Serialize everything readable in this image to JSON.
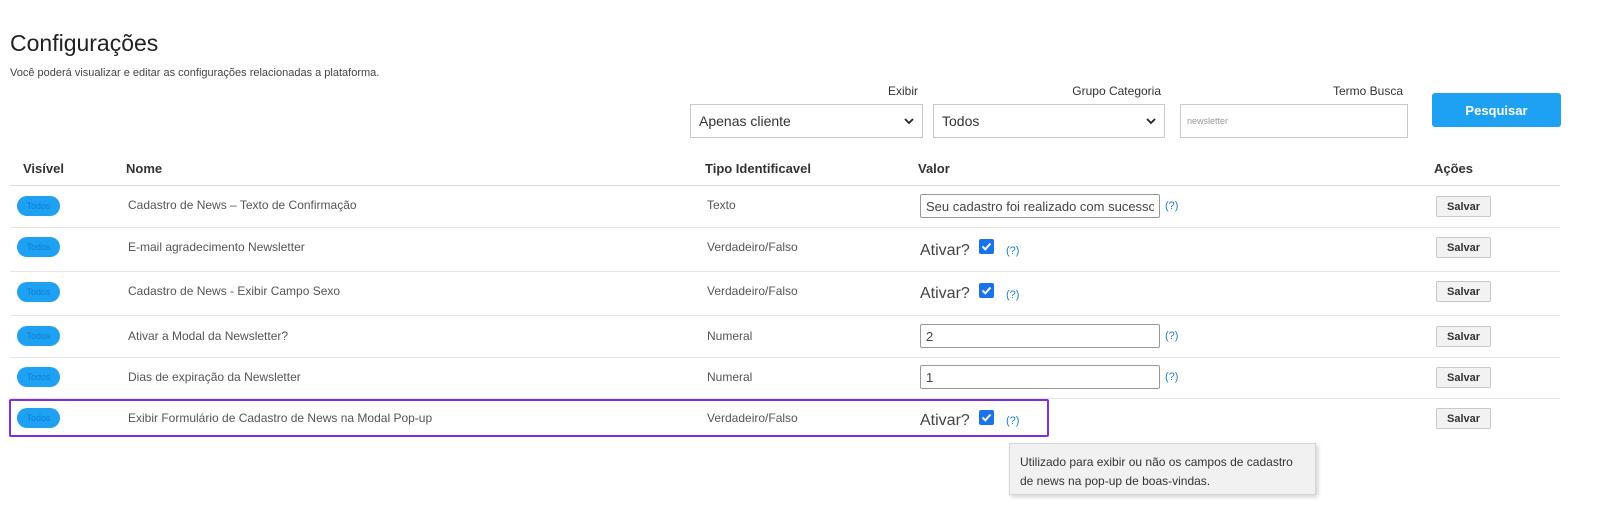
{
  "header": {
    "title": "Configurações",
    "subtitle": "Você poderá visualizar e editar as configurações relacionadas a plataforma."
  },
  "filters": {
    "exibir": {
      "label": "Exibir",
      "value": "Apenas cliente"
    },
    "grupo": {
      "label": "Grupo Categoria",
      "value": "Todos"
    },
    "termo": {
      "label": "Termo Busca",
      "placeholder": "newsletter",
      "value": ""
    },
    "search_button": "Pesquisar"
  },
  "table": {
    "columns": {
      "visivel": "Visível",
      "nome": "Nome",
      "tipo": "Tipo Identificavel",
      "valor": "Valor",
      "acoes": "Ações"
    },
    "rows": [
      {
        "badge": "Todos",
        "name": "Cadastro de News – Texto de Confirmação",
        "type": "Texto",
        "kind": "text",
        "value": "Seu cadastro foi realizado com sucesso!",
        "help": "(?)",
        "save": "Salvar"
      },
      {
        "badge": "Todos",
        "name": "E-mail agradecimento Newsletter",
        "type": "Verdadeiro/Falso",
        "kind": "bool",
        "bool_label": "Ativar?",
        "checked": true,
        "help": "(?)",
        "save": "Salvar"
      },
      {
        "badge": "Todos",
        "name": "Cadastro de News - Exibir Campo Sexo",
        "type": "Verdadeiro/Falso",
        "kind": "bool",
        "bool_label": "Ativar?",
        "checked": true,
        "help": "(?)",
        "save": "Salvar"
      },
      {
        "badge": "Todos",
        "name": "Ativar a Modal da Newsletter?",
        "type": "Numeral",
        "kind": "text",
        "value": "2",
        "help": "(?)",
        "save": "Salvar"
      },
      {
        "badge": "Todos",
        "name": "Dias de expiração da Newsletter",
        "type": "Numeral",
        "kind": "text",
        "value": "1",
        "help": "(?)",
        "save": "Salvar"
      },
      {
        "badge": "Todos",
        "name": "Exibir Formulário de Cadastro de News na Modal Pop-up",
        "type": "Verdadeiro/Falso",
        "kind": "bool",
        "bool_label": "Ativar?",
        "checked": true,
        "help": "(?)",
        "save": "Salvar"
      }
    ]
  },
  "tooltip": {
    "text": "Utilizado para exibir ou não os campos de cadastro de news na pop-up de boas-vindas."
  },
  "colors": {
    "accent": "#1ea1f2",
    "checkbox": "#1a73e8",
    "highlight": "#7b2fe0",
    "help_link": "#1a7fc7"
  },
  "icons": {
    "select_arrow": "chevron-down-icon",
    "checkbox": "checkmark-icon"
  }
}
